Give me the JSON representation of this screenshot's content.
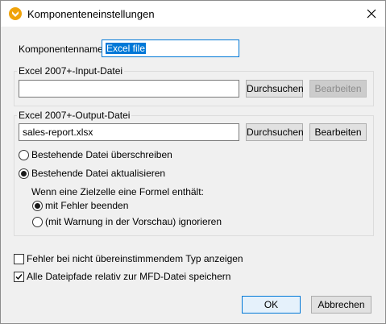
{
  "window": {
    "title": "Komponenteneinstellungen",
    "icon": "altova-mapforce-icon"
  },
  "component_name": {
    "label": "Komponentenname:",
    "value": "Excel file"
  },
  "input_group": {
    "legend": "Excel 2007+-Input-Datei",
    "value": "",
    "browse_label": "Durchsuchen",
    "edit_label": "Bearbeiten"
  },
  "output_group": {
    "legend": "Excel 2007+-Output-Datei",
    "value": "sales-report.xlsx",
    "browse_label": "Durchsuchen",
    "edit_label": "Bearbeiten",
    "overwrite_label": "Bestehende Datei überschreiben",
    "update_label": "Bestehende Datei aktualisieren",
    "formula_question": "Wenn eine Zielzelle eine Formel enthält:",
    "abort_label": "mit Fehler beenden",
    "ignore_label": "(mit Warnung in der Vorschau) ignorieren",
    "selected_mode": "update",
    "selected_formula_option": "abort"
  },
  "options": {
    "type_mismatch_label": "Fehler bei nicht übereinstimmendem Typ anzeigen",
    "type_mismatch_checked": false,
    "relative_paths_label": "Alle Dateipfade relativ zur MFD-Datei speichern",
    "relative_paths_checked": true
  },
  "footer": {
    "ok_label": "OK",
    "cancel_label": "Abbrechen"
  },
  "colors": {
    "accent": "#0078d7",
    "icon_bg": "#f0a30a"
  }
}
